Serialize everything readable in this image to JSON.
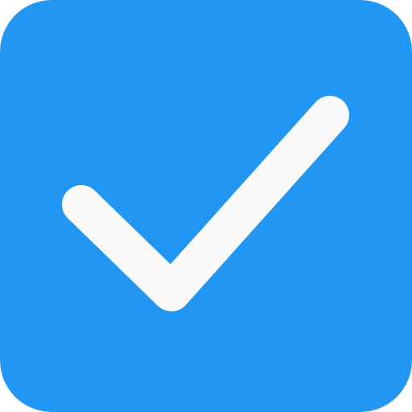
{
  "checkbox": {
    "checked": true,
    "icon": "check-icon",
    "box_color": "#2196F3",
    "mark_color": "#FAFAFA"
  }
}
